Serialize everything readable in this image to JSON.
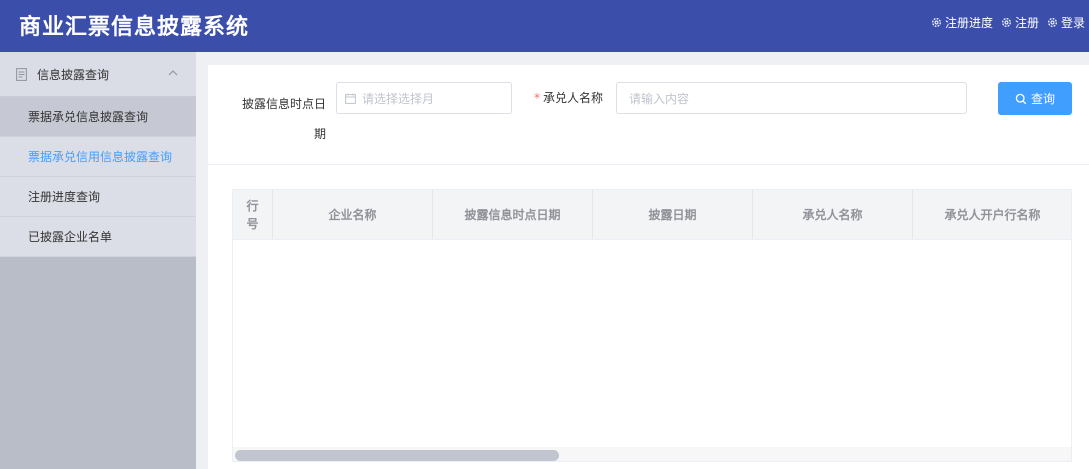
{
  "header": {
    "title": "商业汇票信息披露系统",
    "links": [
      {
        "label": "注册进度",
        "icon": "gear-icon"
      },
      {
        "label": "注册",
        "icon": "gear-icon"
      },
      {
        "label": "登录",
        "icon": "gear-icon"
      }
    ]
  },
  "sidebar": {
    "group_label": "信息披露查询",
    "items": [
      {
        "label": "票据承兑信息披露查询",
        "state": "selected"
      },
      {
        "label": "票据承兑信用信息披露查询",
        "state": "active"
      },
      {
        "label": "注册进度查询",
        "state": "normal"
      },
      {
        "label": "已披露企业名单",
        "state": "normal"
      }
    ]
  },
  "form": {
    "date_label_line1": "披露信息时点日",
    "date_label_line2": "期",
    "date_placeholder": "请选择选择月",
    "name_required": "*",
    "name_label": "承兑人名称",
    "name_placeholder": "请输入内容",
    "query_label": "查询"
  },
  "table": {
    "index_header_line1": "行",
    "index_header_line2": "号",
    "columns": [
      "企业名称",
      "披露信息时点日期",
      "披露日期",
      "承兑人名称",
      "承兑人开户行名称"
    ],
    "rows": []
  },
  "colors": {
    "header_bg": "#3b4eaa",
    "accent": "#409eff",
    "required": "#f56c6c"
  }
}
